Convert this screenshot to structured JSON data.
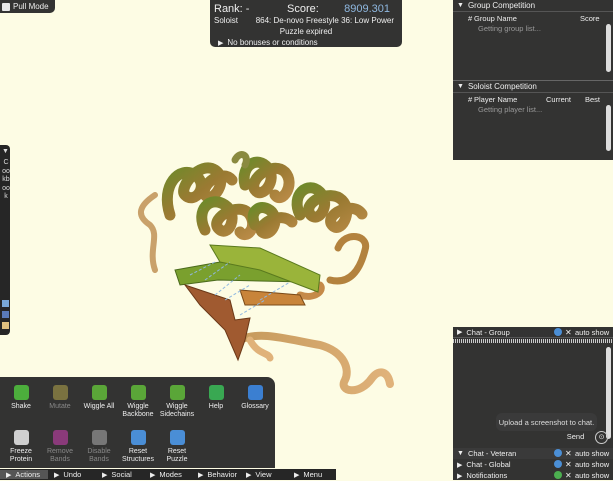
{
  "pull_mode": {
    "label": "Pull Mode"
  },
  "score_box": {
    "rank_label": "Rank: -",
    "score_label": "Score:",
    "score_value": "8909.301",
    "mode": "Soloist",
    "puzzle_name": "864: De-novo Freestyle 36: Low Power",
    "status": "Puzzle expired",
    "bonuses": "No bonuses or conditions"
  },
  "group_competition": {
    "title": "Group Competition",
    "col_hash": "#",
    "col_name": "Group Name",
    "col_score": "Score",
    "loading": "Getting group list..."
  },
  "soloist_competition": {
    "title": "Soloist Competition",
    "col_hash": "#",
    "col_name": "Player Name",
    "col_current": "Current",
    "col_best": "Best",
    "loading": "Getting player list..."
  },
  "cookbook": {
    "label": "Cookbook"
  },
  "tools": [
    {
      "label": "Shake",
      "enabled": true,
      "icon": "shake-icon",
      "color": "#4cae3c"
    },
    {
      "label": "Mutate",
      "enabled": false,
      "icon": "mutate-icon",
      "color": "#7a7240"
    },
    {
      "label": "Wiggle All",
      "enabled": true,
      "icon": "wiggle-all-icon",
      "color": "#5aa638"
    },
    {
      "label": "Wiggle Backbone",
      "enabled": true,
      "icon": "wiggle-backbone-icon",
      "color": "#5aa638"
    },
    {
      "label": "Wiggle Sidechains",
      "enabled": true,
      "icon": "wiggle-sidechains-icon",
      "color": "#5aa638"
    },
    {
      "label": "Help",
      "enabled": true,
      "icon": "help-icon",
      "color": "#39a852"
    },
    {
      "label": "Glossary",
      "enabled": true,
      "icon": "glossary-icon",
      "color": "#3b7fd1"
    },
    {
      "label": "Freeze Protein",
      "enabled": true,
      "icon": "freeze-icon",
      "color": "#cfcfcf"
    },
    {
      "label": "Remove Bands",
      "enabled": false,
      "icon": "remove-bands-icon",
      "color": "#8a3a7a"
    },
    {
      "label": "Disable Bands",
      "enabled": false,
      "icon": "disable-bands-icon",
      "color": "#777777"
    },
    {
      "label": "Reset Structures",
      "enabled": true,
      "icon": "reset-structures-icon",
      "color": "#4a8ed6"
    },
    {
      "label": "Reset Puzzle",
      "enabled": true,
      "icon": "reset-puzzle-icon",
      "color": "#4a8ed6"
    }
  ],
  "bottom_menu": [
    "Actions",
    "Undo",
    "Social",
    "Modes",
    "Behavior",
    "View",
    "Menu"
  ],
  "chat": {
    "group_title": "Chat - Group",
    "auto_show": "auto show",
    "tooltip": "Upload a screenshot to chat.",
    "send_label": "Send",
    "tabs": [
      "Chat - Veteran",
      "Chat - Global",
      "Notifications"
    ]
  },
  "colors": {
    "panel_bg": "#262626",
    "canvas_bg": "#fdfce4",
    "score_value": "#8fb8e0",
    "info_badge": "#4b8fd6",
    "notification_badge": "#4caf50"
  }
}
